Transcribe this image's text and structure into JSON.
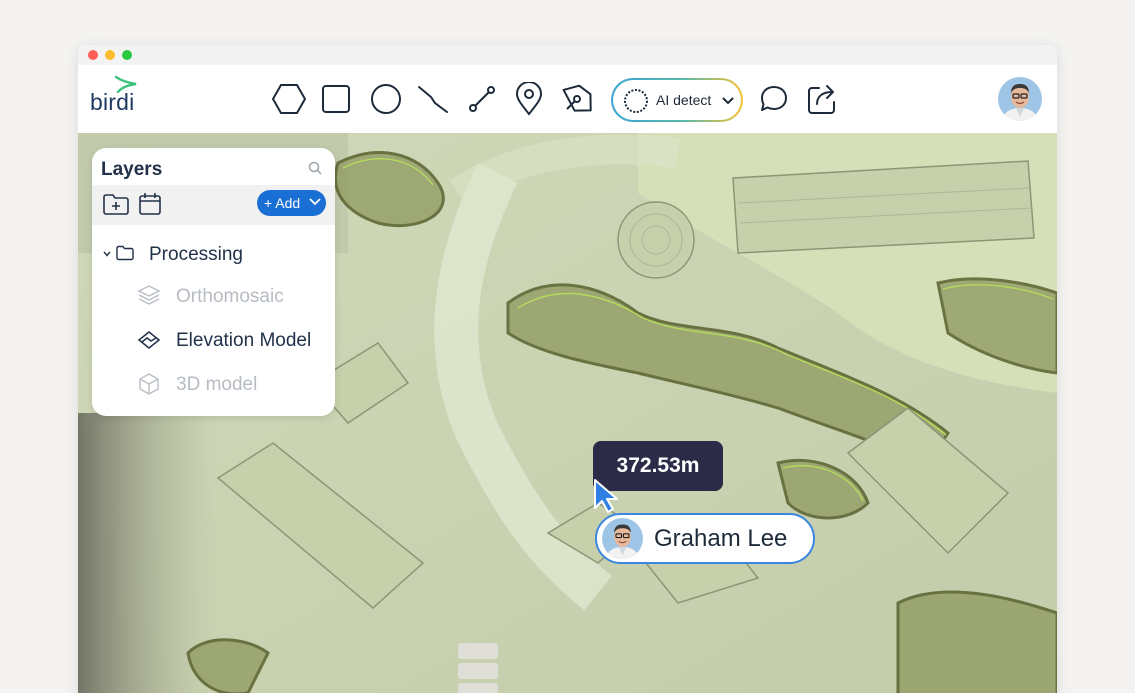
{
  "app": {
    "logo_text": "birdi"
  },
  "toolbar": {
    "tools": [
      {
        "name": "polygon-tool",
        "icon": "hexagon-icon"
      },
      {
        "name": "rectangle-tool",
        "icon": "square-icon"
      },
      {
        "name": "circle-tool",
        "icon": "circle-icon"
      },
      {
        "name": "polyline-tool",
        "icon": "polyline-icon"
      },
      {
        "name": "measure-line-tool",
        "icon": "line-icon"
      },
      {
        "name": "pin-tool",
        "icon": "map-pin-icon"
      },
      {
        "name": "pen-tool",
        "icon": "pen-nib-icon"
      }
    ],
    "ai_detect_label": "AI detect",
    "comment_icon": "chat-bubble-icon",
    "share_icon": "share-icon"
  },
  "layers": {
    "title": "Layers",
    "add_label": "+ Add",
    "items": [
      {
        "label": "Processing",
        "icon": "folder-icon",
        "state": "expanded"
      },
      {
        "label": "Orthomosaic",
        "icon": "stack-icon",
        "state": "disabled"
      },
      {
        "label": "Elevation Model",
        "icon": "elevation-icon",
        "state": "active"
      },
      {
        "label": "3D model",
        "icon": "cube-icon",
        "state": "disabled"
      }
    ]
  },
  "measurement": {
    "value": "372.53m"
  },
  "collaborator": {
    "name": "Graham Lee"
  },
  "colors": {
    "brand_navy": "#22324a",
    "accent_blue": "#1a6fd4",
    "tooltip_bg": "#2b2b47",
    "map_tint": "#cbd5b4",
    "vegetation_outline": "#b9e05a"
  }
}
